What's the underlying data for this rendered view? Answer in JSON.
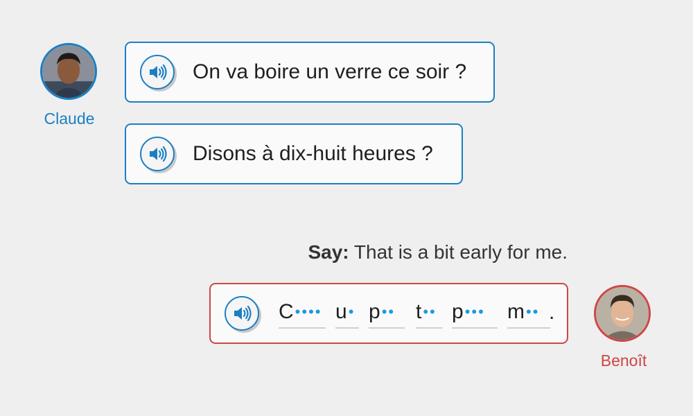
{
  "conversation": {
    "speaker1": {
      "name": "Claude",
      "messages": [
        {
          "text": "On va boire un verre ce soir ?"
        },
        {
          "text": "Disons à dix-huit heures ?"
        }
      ]
    },
    "speaker2": {
      "name": "Benoît"
    },
    "prompt": {
      "label": "Say:",
      "text": "That is a bit early for me."
    },
    "reply": {
      "words": [
        {
          "letter": "C",
          "dots": "••••"
        },
        {
          "letter": "u",
          "dots": "•"
        },
        {
          "letter": "p",
          "dots": "••"
        },
        {
          "letter": "t",
          "dots": "••"
        },
        {
          "letter": "p",
          "dots": "•••"
        },
        {
          "letter": "m",
          "dots": "••"
        }
      ],
      "end_punctuation": "."
    }
  },
  "icons": {
    "audio": "speaker-icon",
    "avatar": "avatar-photo"
  },
  "colors": {
    "speaker1_accent": "#1a7fc4",
    "speaker2_accent": "#d04545",
    "hint_dots": "#1a9be0",
    "background": "#efefef"
  }
}
